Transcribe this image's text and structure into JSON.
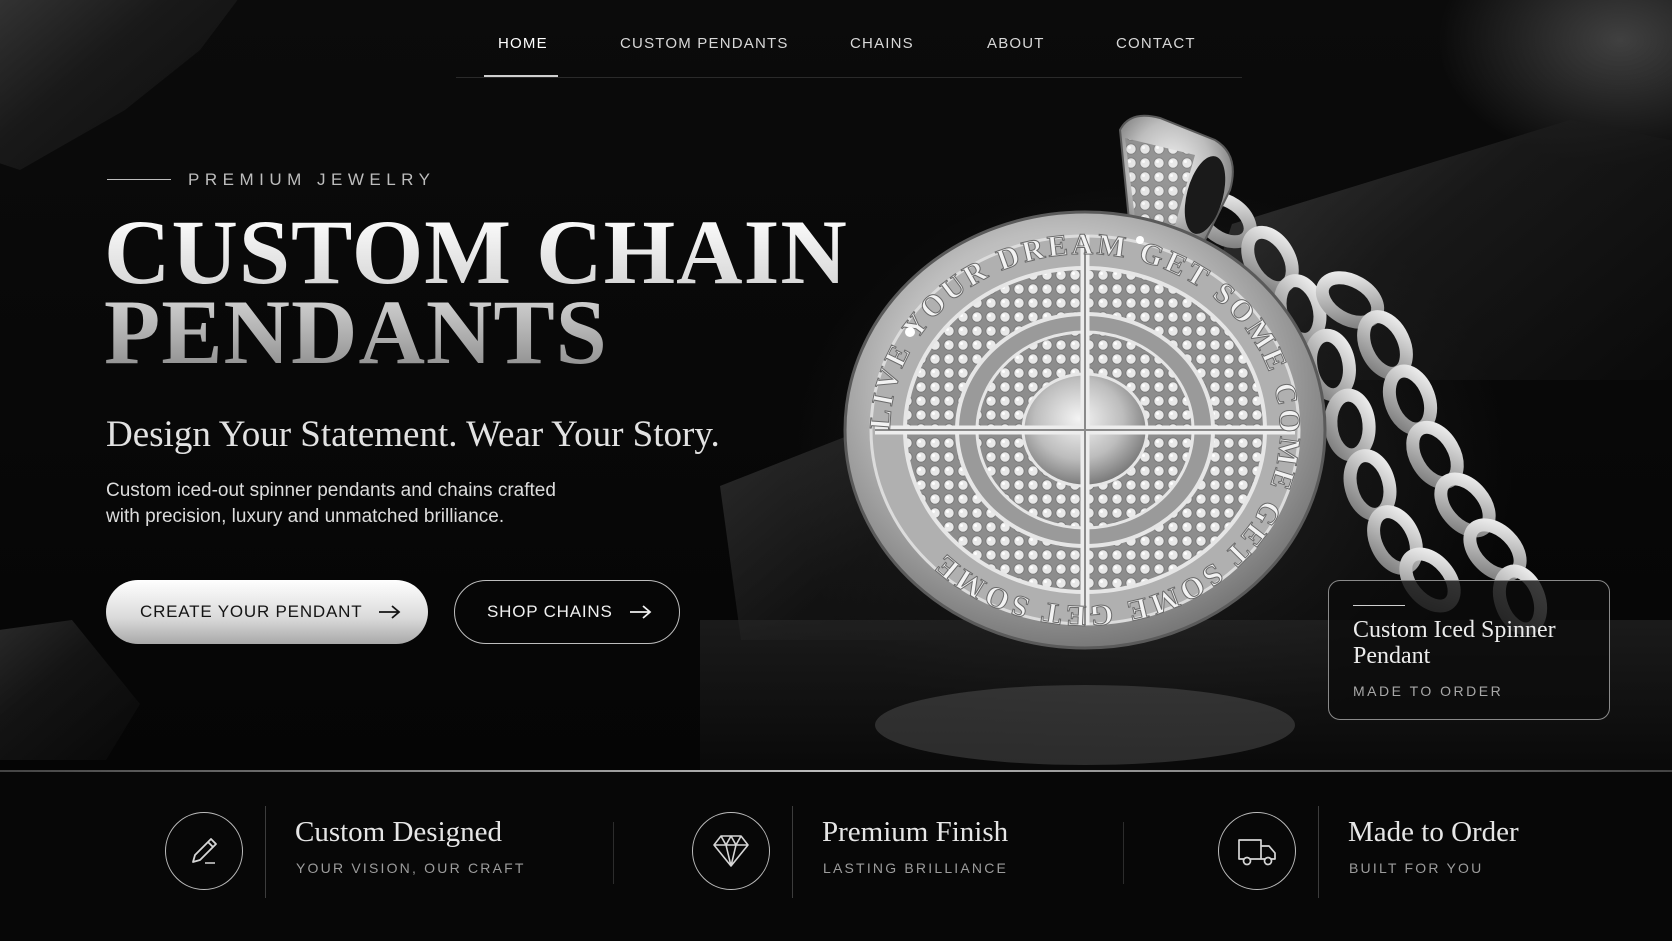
{
  "nav": {
    "items": [
      "HOME",
      "CUSTOM PENDANTS",
      "CHAINS",
      "ABOUT",
      "CONTACT"
    ],
    "active": "HOME"
  },
  "hero": {
    "eyebrow": "PREMIUM JEWELRY",
    "title_line1": "CUSTOM CHAIN",
    "title_line2": "PENDANTS",
    "subtitle": "Design Your Statement. Wear Your Story.",
    "description_line1": "Custom iced-out spinner pendants and chains crafted",
    "description_line2": "with precision, luxury and unmatched brilliance.",
    "primary_cta": "CREATE YOUR PENDANT",
    "secondary_cta": "SHOP CHAINS"
  },
  "pendant": {
    "engraving": "LIVE YOUR DREAM GET SOME COME GET SOME GET SOME"
  },
  "product_card": {
    "title": "Custom Iced Spinner Pendant",
    "subtitle": "MADE TO ORDER"
  },
  "features": [
    {
      "icon": "pencil-icon",
      "title": "Custom Designed",
      "subtitle": "YOUR VISION, OUR CRAFT"
    },
    {
      "icon": "diamond-icon",
      "title": "Premium Finish",
      "subtitle": "LASTING BRILLIANCE"
    },
    {
      "icon": "truck-icon",
      "title": "Made to Order",
      "subtitle": "BUILT FOR YOU"
    }
  ],
  "colors": {
    "background": "#060606",
    "silver": "#cfcfcf",
    "text": "#e6e6e6",
    "muted": "#9c9c9c"
  }
}
